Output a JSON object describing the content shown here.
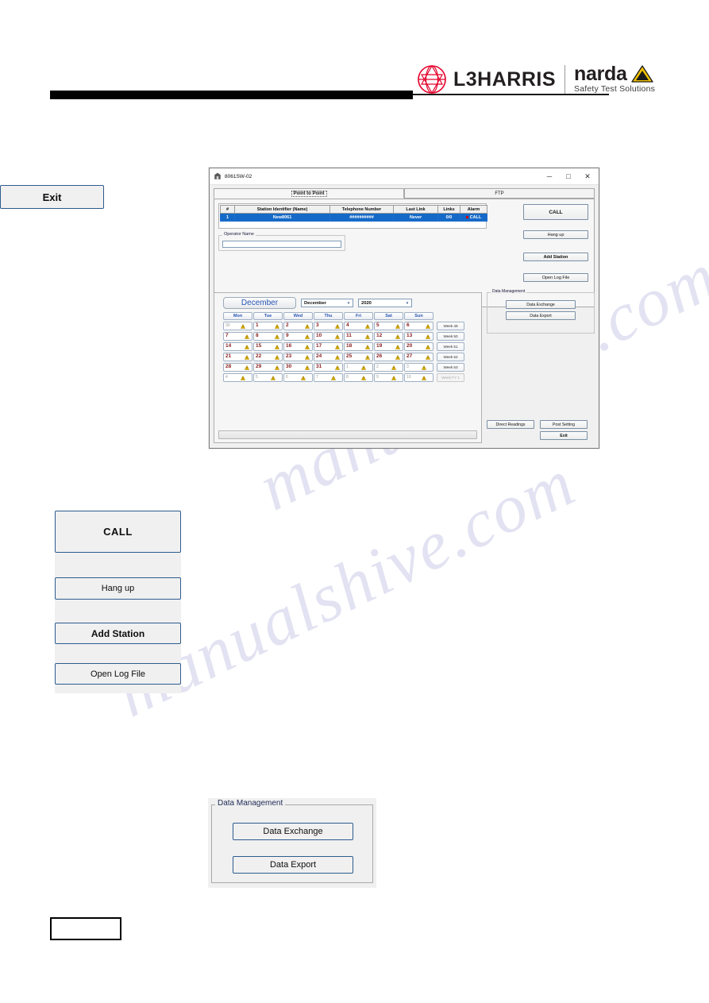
{
  "page": {
    "brand": {
      "l3harris": "L3HARRIS",
      "narda": "narda",
      "narda_tagline": "Safety Test Solutions",
      "logo_red": "#e4002b",
      "narda_yellow": "#f2c200"
    }
  },
  "window": {
    "title": "8061SW-02",
    "icon": "app-icon",
    "controls": {
      "minimize": "─",
      "maximize": "□",
      "close": "✕"
    },
    "tabs": [
      {
        "label": "Point to Point",
        "active": true
      },
      {
        "label": "FTP",
        "active": false
      }
    ],
    "station_table": {
      "headers": [
        "#",
        "Station Identifier (Name)",
        "Telephone Number",
        "Last Link",
        "Links",
        "Alarm"
      ],
      "rows": [
        {
          "index": "1",
          "station_identifier": "New8061",
          "telephone_number": "##########",
          "last_link": "Never",
          "links": "0/0",
          "alarm": "CALL",
          "alarm_color": "#d40000",
          "selected": true
        }
      ]
    },
    "operator": {
      "legend": "Operator Name",
      "value": "",
      "placeholder": ""
    },
    "action_buttons": {
      "call": "CALL",
      "hang_up": "Hang up",
      "add_station": "Add Station",
      "open_log_file": "Open Log File"
    },
    "calendar": {
      "month_button": "December",
      "month_select": "December",
      "year_select": "2020",
      "dropdown_arrow": "▾",
      "day_headers": [
        "Mon",
        "Tue",
        "Wed",
        "Thu",
        "Fri",
        "Sat",
        "Sun"
      ],
      "weeks": [
        {
          "label": "Week 49",
          "label_muted": false,
          "days": [
            {
              "n": "30",
              "muted": true
            },
            {
              "n": "1",
              "muted": false
            },
            {
              "n": "2",
              "muted": false
            },
            {
              "n": "3",
              "muted": false
            },
            {
              "n": "4",
              "muted": false
            },
            {
              "n": "5",
              "muted": false
            },
            {
              "n": "6",
              "muted": false
            }
          ]
        },
        {
          "label": "Week 50",
          "label_muted": false,
          "days": [
            {
              "n": "7",
              "muted": false
            },
            {
              "n": "8",
              "muted": false
            },
            {
              "n": "9",
              "muted": false
            },
            {
              "n": "10",
              "muted": false
            },
            {
              "n": "11",
              "muted": false
            },
            {
              "n": "12",
              "muted": false
            },
            {
              "n": "13",
              "muted": false
            }
          ]
        },
        {
          "label": "Week 51",
          "label_muted": false,
          "days": [
            {
              "n": "14",
              "muted": false
            },
            {
              "n": "15",
              "muted": false
            },
            {
              "n": "16",
              "muted": false
            },
            {
              "n": "17",
              "muted": false
            },
            {
              "n": "18",
              "muted": false
            },
            {
              "n": "19",
              "muted": false
            },
            {
              "n": "20",
              "muted": false
            }
          ]
        },
        {
          "label": "Week 52",
          "label_muted": false,
          "days": [
            {
              "n": "21",
              "muted": false
            },
            {
              "n": "22",
              "muted": false
            },
            {
              "n": "23",
              "muted": false
            },
            {
              "n": "24",
              "muted": false
            },
            {
              "n": "25",
              "muted": false
            },
            {
              "n": "26",
              "muted": false
            },
            {
              "n": "27",
              "muted": false
            }
          ]
        },
        {
          "label": "Week 53",
          "label_muted": false,
          "days": [
            {
              "n": "28",
              "muted": false
            },
            {
              "n": "29",
              "muted": false
            },
            {
              "n": "30",
              "muted": false
            },
            {
              "n": "31",
              "muted": false
            },
            {
              "n": "1",
              "muted": true
            },
            {
              "n": "2",
              "muted": true
            },
            {
              "n": "3",
              "muted": true
            }
          ]
        },
        {
          "label": "Week FY 1",
          "label_muted": true,
          "days": [
            {
              "n": "4",
              "muted": true
            },
            {
              "n": "5",
              "muted": true
            },
            {
              "n": "6",
              "muted": true
            },
            {
              "n": "7",
              "muted": true
            },
            {
              "n": "8",
              "muted": true
            },
            {
              "n": "9",
              "muted": true
            },
            {
              "n": "10",
              "muted": true
            }
          ]
        }
      ]
    },
    "data_management": {
      "legend": "Data Management",
      "data_exchange": "Data Exchange",
      "data_export": "Data Export"
    },
    "bottom_buttons": {
      "direct_readings": "Direct Readings",
      "post_setting": "Post Setting",
      "exit": "Exit"
    }
  },
  "callout_buttons": {
    "call": "CALL",
    "hang_up": "Hang up",
    "add_station": "Add Station",
    "open_log_file": "Open Log File",
    "exit": "Exit"
  },
  "callout_data_management": {
    "legend": "Data Management",
    "data_exchange": "Data Exchange",
    "data_export": "Data Export"
  },
  "watermark": {
    "line1": "manualshive.com",
    "line2": "manualshive.com"
  }
}
